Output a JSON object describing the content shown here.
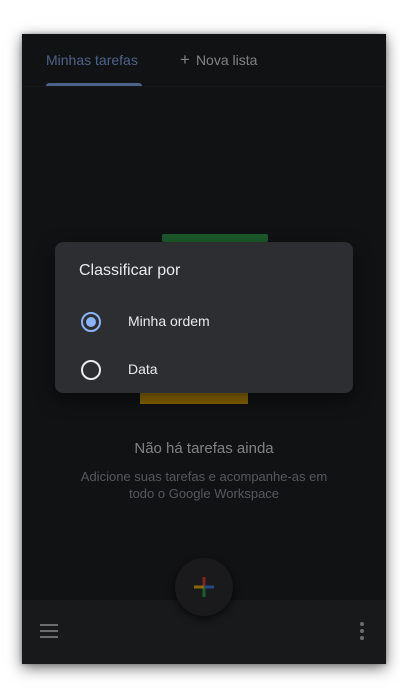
{
  "tabs": {
    "active_label": "Minhas tarefas",
    "new_list_plus": "+",
    "new_list_label": "Nova lista"
  },
  "empty_state": {
    "title": "Não há tarefas ainda",
    "subtitle": "Adicione suas tarefas e acompanhe-as em todo o Google Workspace"
  },
  "sort_dialog": {
    "title": "Classificar por",
    "options": [
      {
        "label": "Minha ordem",
        "selected": true
      },
      {
        "label": "Data",
        "selected": false
      }
    ]
  },
  "bottom_bar": {
    "left_icon": "menu-icon",
    "right_icon": "more-vert-icon"
  },
  "fab": {
    "icon": "add-icon",
    "colors": [
      "#ea4335",
      "#4285f4",
      "#34a853",
      "#fbbc04"
    ]
  },
  "colors": {
    "accent": "#8ab4f8",
    "background": "#202124",
    "surface": "#2d2e31",
    "text": "#e8eaed",
    "muted_text": "#9aa0a6"
  }
}
